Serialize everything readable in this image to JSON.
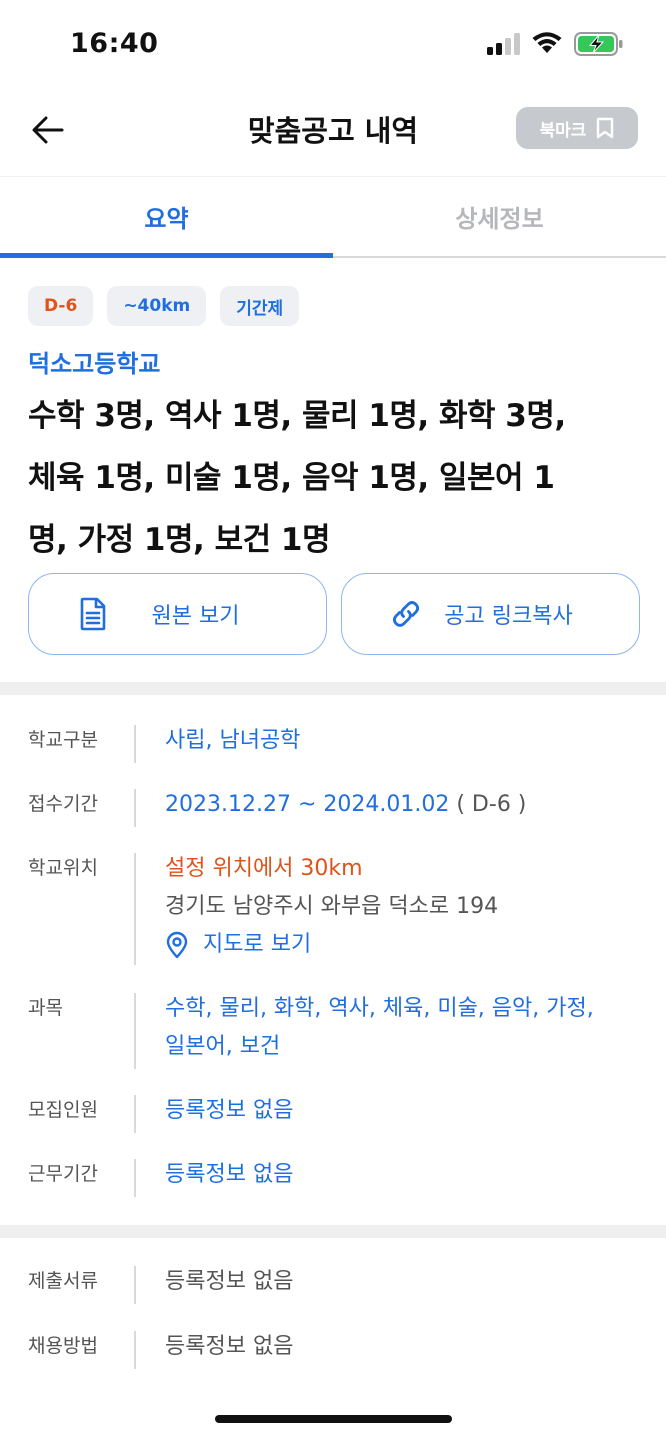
{
  "status": {
    "time": "16:40"
  },
  "header": {
    "title": "맞춤공고 내역",
    "bookmark_label": "북마크"
  },
  "tabs": [
    {
      "label": "요약",
      "active": true
    },
    {
      "label": "상세정보",
      "active": false
    }
  ],
  "summary": {
    "badges": [
      {
        "label": "D-6",
        "color": "#e0531a"
      },
      {
        "label": "~40km",
        "color": "#1f6fe0"
      },
      {
        "label": "기간제",
        "color": "#1f6fe0"
      }
    ],
    "school_name": "덕소고등학교",
    "subjects_lines": [
      "수학 3명, 역사 1명, 물리 1명, 화학 3명,",
      "체육 1명, 미술 1명, 음악 1명, 일본어 1",
      "명, 가정 1명, 보건 1명"
    ],
    "view_original_label": "원본 보기",
    "copy_link_label": "공고 링크복사"
  },
  "info": {
    "school_type": {
      "label": "학교구분",
      "value": "사립, 남녀공학"
    },
    "period": {
      "label": "접수기간",
      "value": "2023.12.27 ~ 2024.01.02",
      "suffix": "( D-6 )"
    },
    "location": {
      "label": "학교위치",
      "distance": "설정 위치에서 30km",
      "address": "경기도 남양주시 와부읍 덕소로 194",
      "map_label": "지도로 보기"
    },
    "subjects": {
      "label": "과목",
      "line1": "수학, 물리, 화학, 역사, 체육, 미술, 음악, 가정,",
      "line2": "일본어, 보건"
    },
    "recruit_count": {
      "label": "모집인원",
      "value": "등록정보 없음"
    },
    "work_period": {
      "label": "근무기간",
      "value": "등록정보 없음"
    },
    "documents": {
      "label": "제출서류",
      "value": "등록정보 없음"
    },
    "hiring_method": {
      "label": "채용방법",
      "value": "등록정보 없음"
    }
  },
  "colors": {
    "accent": "#1f6fe0",
    "warning": "#e0531a",
    "bookmark_bg": "#c6c9cd"
  }
}
